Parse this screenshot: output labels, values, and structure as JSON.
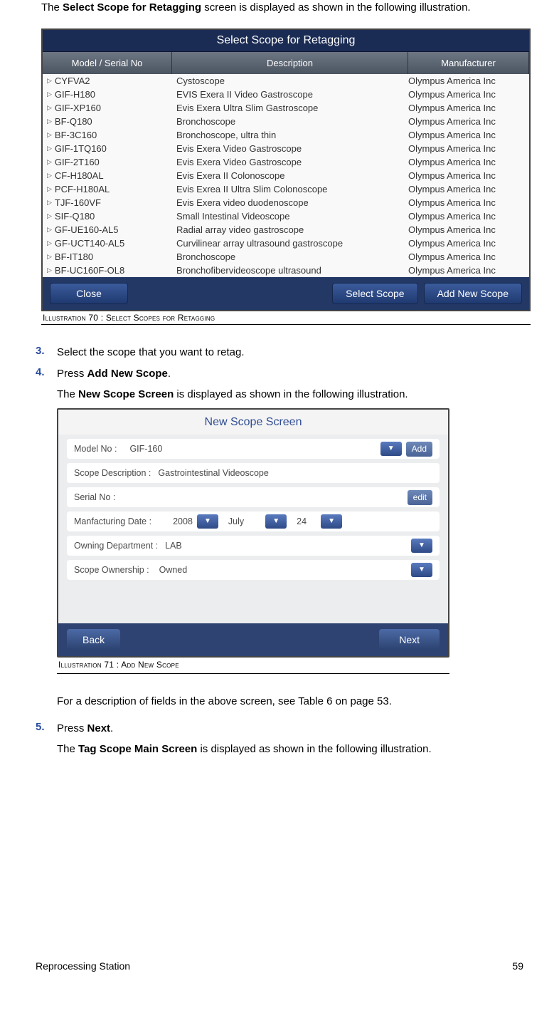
{
  "intro": {
    "pre": "The ",
    "bold": "Select Scope for Retagging",
    "post": " screen is displayed as shown in the following illustration."
  },
  "figure1": {
    "title": "Select Scope for Retagging",
    "headers": {
      "c1": "Model / Serial No",
      "c2": "Description",
      "c3": "Manufacturer"
    },
    "rows": [
      {
        "m": "CYFVA2",
        "d": "Cystoscope",
        "mf": "Olympus America Inc"
      },
      {
        "m": "GIF-H180",
        "d": "EVIS Exera II Video Gastroscope",
        "mf": "Olympus America Inc"
      },
      {
        "m": "GIF-XP160",
        "d": "Evis Exera Ultra Slim Gastroscope",
        "mf": "Olympus America Inc"
      },
      {
        "m": "BF-Q180",
        "d": "Bronchoscope",
        "mf": "Olympus America Inc"
      },
      {
        "m": "BF-3C160",
        "d": "Bronchoscope, ultra thin",
        "mf": "Olympus America Inc"
      },
      {
        "m": "GIF-1TQ160",
        "d": "Evis Exera Video Gastroscope",
        "mf": "Olympus America Inc"
      },
      {
        "m": "GIF-2T160",
        "d": "Evis Exera Video Gastroscope",
        "mf": "Olympus America Inc"
      },
      {
        "m": "CF-H180AL",
        "d": "Evis Exera II Colonoscope",
        "mf": "Olympus America Inc"
      },
      {
        "m": "PCF-H180AL",
        "d": "Evis Exrea II Ultra Slim Colonoscope",
        "mf": "Olympus America Inc"
      },
      {
        "m": "TJF-160VF",
        "d": "Evis Exera video duodenoscope",
        "mf": "Olympus America Inc"
      },
      {
        "m": "SIF-Q180",
        "d": "Small Intestinal Videoscope",
        "mf": "Olympus America Inc"
      },
      {
        "m": "GF-UE160-AL5",
        "d": "Radial array video gastroscope",
        "mf": "Olympus America Inc"
      },
      {
        "m": "GF-UCT140-AL5",
        "d": "Curvilinear array ultrasound gastroscope",
        "mf": "Olympus America Inc"
      },
      {
        "m": "BF-IT180",
        "d": "Bronchoscope",
        "mf": "Olympus America Inc"
      },
      {
        "m": "BF-UC160F-OL8",
        "d": "Bronchofibervideoscope  ultrasound",
        "mf": "Olympus America Inc"
      }
    ],
    "buttons": {
      "close": "Close",
      "select": "Select Scope",
      "add": "Add New Scope"
    },
    "caption": "Illustration 70 : Select Scopes for Retagging"
  },
  "steps": {
    "s3": {
      "num": "3.",
      "text": "Select the scope that you want to retag."
    },
    "s4": {
      "num": "4.",
      "line1_pre": "Press ",
      "line1_bold": "Add New Scope",
      "line1_post": ".",
      "line2_pre": "The ",
      "line2_bold": "New Scope Screen",
      "line2_post": " is displayed as shown in the following illustration."
    },
    "s5": {
      "num": "5.",
      "line0": "For a description of fields in the above screen, see Table 6 on page 53.",
      "line1_pre": "Press ",
      "line1_bold": "Next",
      "line1_post": ".",
      "line2_pre": "The ",
      "line2_bold": "Tag Scope Main  Screen",
      "line2_post": " is displayed as shown in the following illustration."
    }
  },
  "figure2": {
    "title": "New Scope Screen",
    "fields": {
      "model": {
        "label": "Model No :",
        "value": "GIF-160",
        "add": "Add"
      },
      "desc": {
        "label": "Scope Description :",
        "value": "Gastrointestinal Videoscope"
      },
      "serial": {
        "label": "Serial No :",
        "edit": "edit"
      },
      "mfg": {
        "label": "Manfacturing Date :",
        "year": "2008",
        "month": "July",
        "day": "24"
      },
      "dept": {
        "label": "Owning Department :",
        "value": "LAB"
      },
      "own": {
        "label": "Scope Ownership :",
        "value": "Owned"
      }
    },
    "buttons": {
      "back": "Back",
      "next": "Next"
    },
    "caption": "Illustration 71 : Add New Scope"
  },
  "footer": {
    "left": "Reprocessing Station",
    "right": "59"
  }
}
